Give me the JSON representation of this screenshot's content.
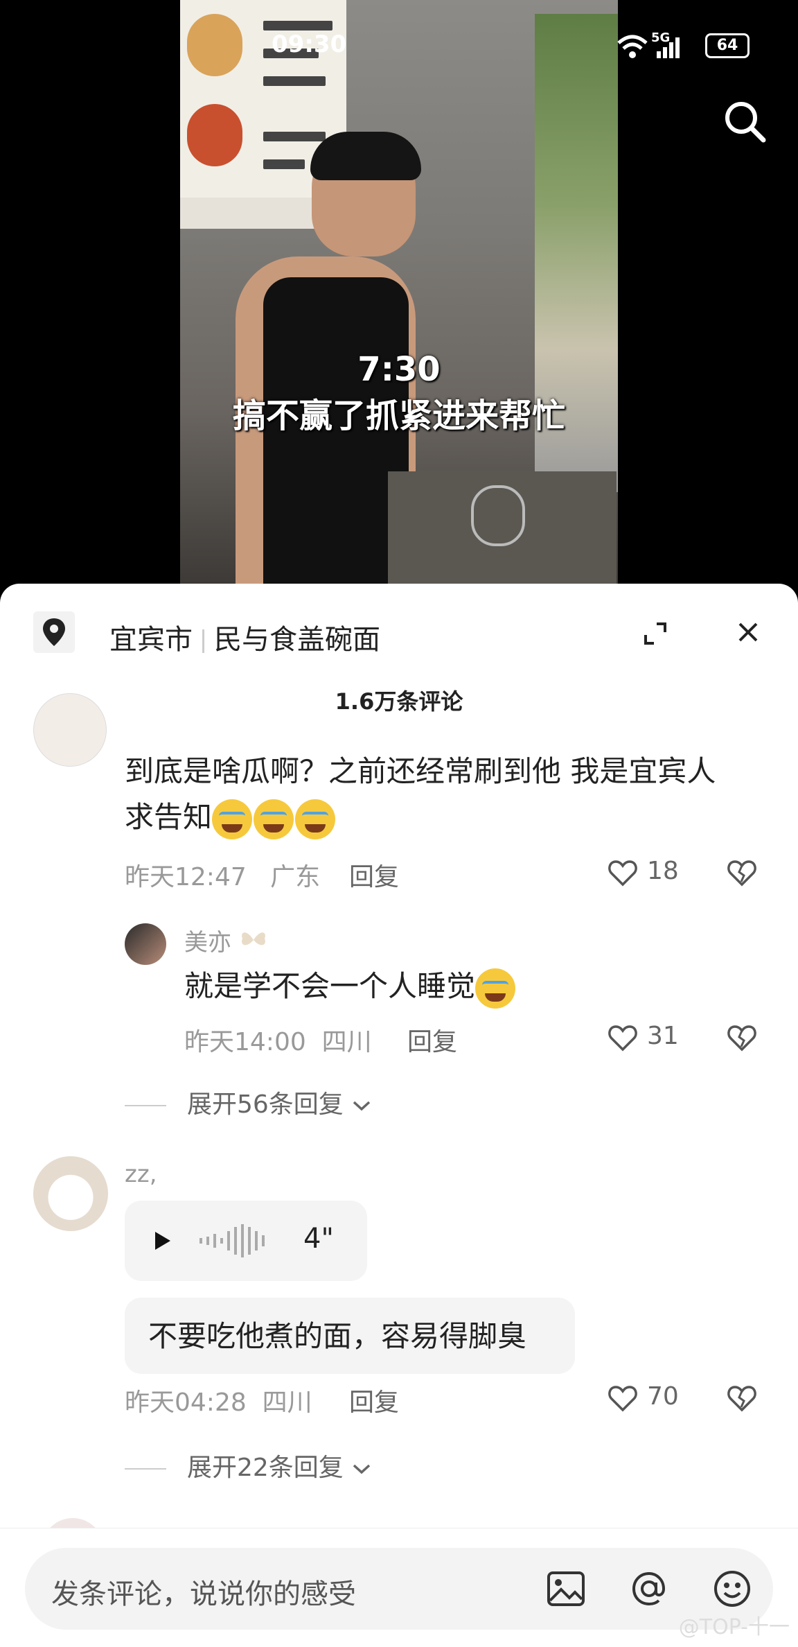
{
  "status_bar": {
    "time": "09:30",
    "signal_label": "5G",
    "battery": "64"
  },
  "video": {
    "caption_time": "7:30",
    "caption_text": "搞不赢了抓紧进来帮忙"
  },
  "sheet": {
    "location_city": "宜宾市",
    "location_place": "民与食盖碗面",
    "comment_count": "1.6万条评论"
  },
  "comments": [
    {
      "text_line1": "到底是啥瓜啊？之前还经常刷到他  我是宜宾人",
      "text_line2": "求告知",
      "time": "昨天12:47",
      "region": "广东",
      "reply_label": "回复",
      "likes": "18"
    },
    {
      "user": "美亦",
      "text": "就是学不会一个人睡觉",
      "time": "昨天14:00",
      "region": "四川",
      "reply_label": "回复",
      "likes": "31",
      "expand_label": "展开56条回复"
    },
    {
      "user": "zz,",
      "voice_duration": "4\"",
      "text": "不要吃他煮的面，容易得脚臭",
      "time": "昨天04:28",
      "region": "四川",
      "reply_label": "回复",
      "likes": "70",
      "expand_label": "展开22条回复"
    }
  ],
  "input": {
    "placeholder": "发条评论，说说你的感受"
  },
  "watermark": "@TOP-十一",
  "colors": {
    "sheet_bg": "#ffffff",
    "meta_gray": "#999999",
    "text_dark": "#222222"
  }
}
